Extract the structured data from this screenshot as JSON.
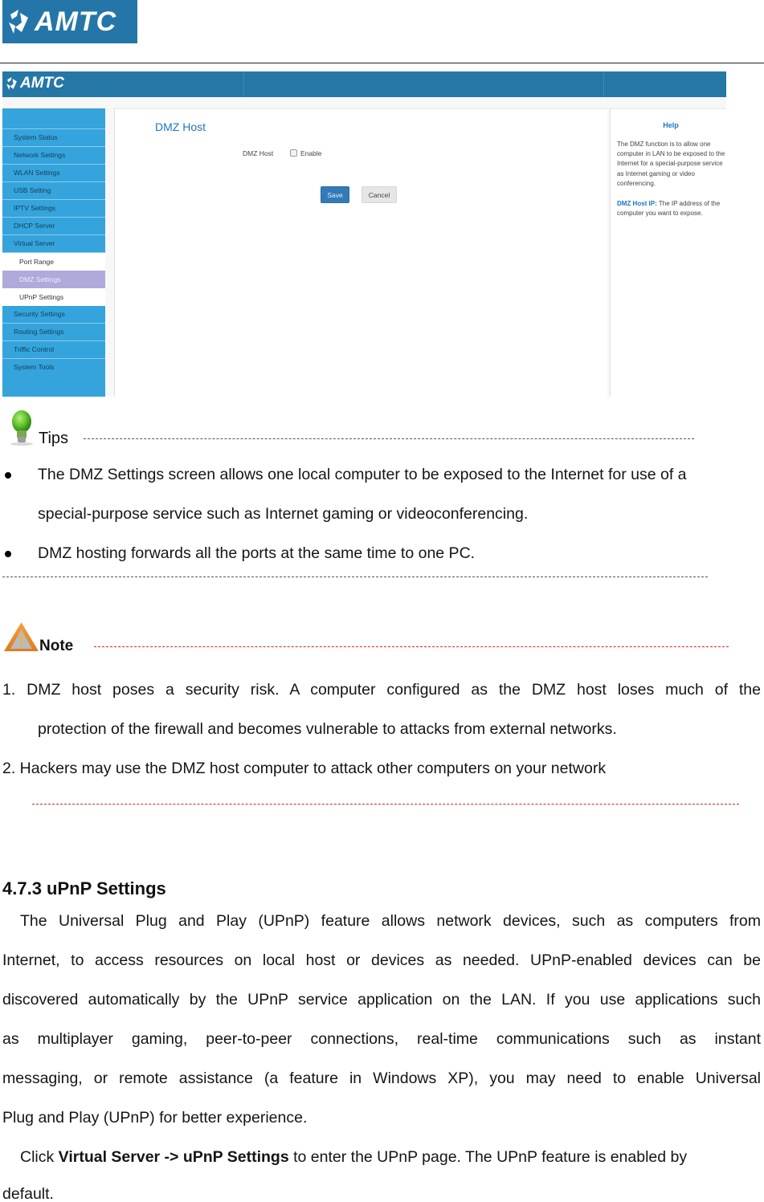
{
  "doc_header": {
    "logo_text": "AMTC"
  },
  "router_ui": {
    "logo_text": "AMTC",
    "sidebar": {
      "items": [
        {
          "label": "System Status"
        },
        {
          "label": "Network Settings"
        },
        {
          "label": "WLAN Settings"
        },
        {
          "label": "USB Setting"
        },
        {
          "label": "IPTV Settings"
        },
        {
          "label": "DHCP Server"
        },
        {
          "label": "Virtual Server"
        }
      ],
      "subitems": [
        {
          "label": "Port Range",
          "active": false
        },
        {
          "label": "DMZ Settings",
          "active": true
        },
        {
          "label": "UPnP Settings",
          "active": false
        }
      ],
      "items_after": [
        {
          "label": "Security Settings"
        },
        {
          "label": "Routing Settings"
        },
        {
          "label": "Triffic Control"
        },
        {
          "label": "System Tools"
        }
      ]
    },
    "main": {
      "title": "DMZ Host",
      "field_label": "DMZ Host",
      "enable_label": "Enable",
      "enable_checked": false,
      "save_label": "Save",
      "cancel_label": "Cancel"
    },
    "help": {
      "title": "Help",
      "description": "The DMZ function is to allow one computer in LAN to be exposed to the Internet for a special-purpose service as Internet gaming or video conferencing.",
      "ip_term": "DMZ Host IP:",
      "ip_desc": " The IP address of the computer you want to expose."
    },
    "colors": {
      "header": "#2577a6",
      "sidebar": "#35a4dc",
      "active_subitem": "#aeaadb",
      "accent": "#1f74c4",
      "save_button": "#337ab7"
    }
  },
  "tips": {
    "title": "Tips",
    "bullets": [
      {
        "line1": "The DMZ Settings screen allows one local computer to be exposed to the Internet for use of a",
        "line2": "special-purpose service such as Internet gaming or videoconferencing."
      },
      {
        "line1": "DMZ hosting forwards all the ports at the same time to one PC."
      }
    ]
  },
  "note": {
    "title": "Note",
    "items": [
      {
        "line1": "1. DMZ host poses a security risk. A computer configured as the DMZ host loses much of the",
        "line2": "protection of the firewall and becomes vulnerable to attacks from external networks."
      },
      {
        "line1": "2. Hackers may use the DMZ host computer to attack other computers on your network"
      }
    ]
  },
  "section": {
    "title": "4.7.3 uPnP Settings",
    "paragraph_lines": [
      "The Universal Plug and Play (UPnP) feature allows network devices, such as computers from",
      "Internet, to access resources on local host or devices as needed. UPnP-enabled devices can be",
      "discovered automatically by the UPnP service application on the LAN. If you use applications such",
      "as multiplayer gaming, peer-to-peer connections, real-time communications such as instant",
      "messaging, or remote assistance (a feature in Windows XP), you may need to enable Universal",
      "Plug and Play (UPnP) for better experience."
    ],
    "click_prefix": "Click ",
    "click_path": "Virtual Server -> uPnP Settings",
    "click_suffix": " to enter the UPnP page. The UPnP feature is enabled by",
    "click_last_line": "default."
  }
}
